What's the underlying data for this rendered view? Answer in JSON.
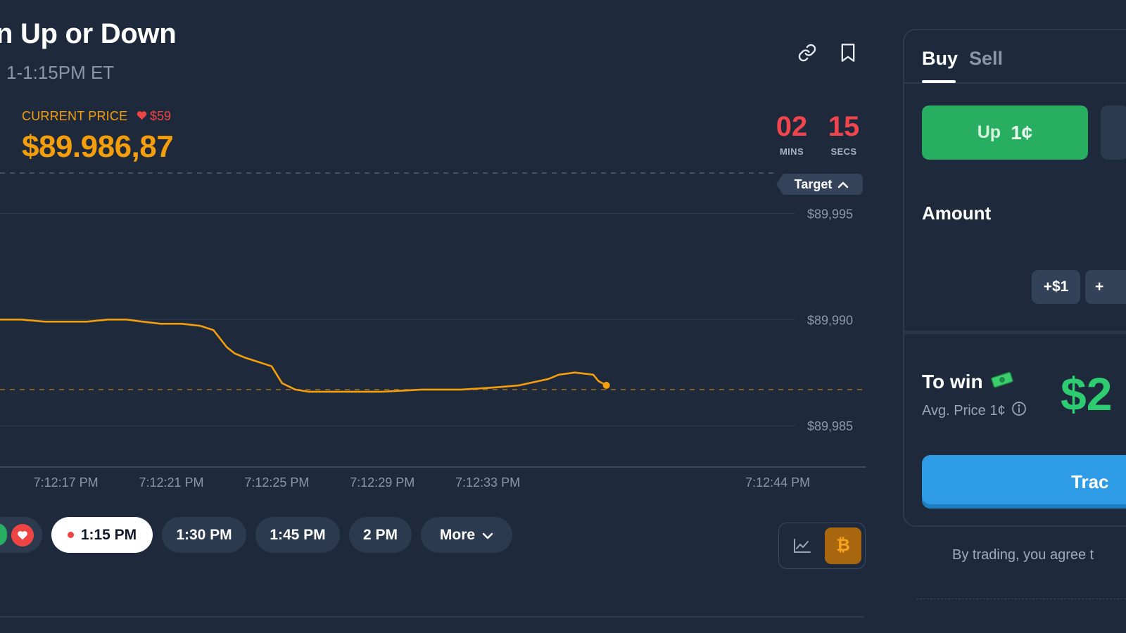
{
  "header": {
    "title": "n Up or Down",
    "subtitle": "1-1:15PM ET",
    "link_icon": "link-icon",
    "bookmark_icon": "bookmark-icon"
  },
  "price": {
    "label": "CURRENT PRICE",
    "change": "$59",
    "change_direction": "down",
    "value": "$89.986,87"
  },
  "countdown": {
    "mins": "02",
    "mins_label": "MINS",
    "secs": "15",
    "secs_label": "SECS"
  },
  "colors": {
    "background": "#1e2a3c",
    "accent_orange": "#f59e0b",
    "up_green": "#27ae60",
    "down_red": "#ef4444",
    "trade_blue": "#2e9be6"
  },
  "chart_data": {
    "type": "line",
    "target_label": "Target",
    "y_ticks": [
      "$89,995",
      "$89,990",
      "$89,985"
    ],
    "y_tick_values": [
      89995,
      89990,
      89985
    ],
    "ylim": [
      89983.05,
      89997.1
    ],
    "x_ticks": [
      "7:12:17 PM",
      "7:12:21 PM",
      "7:12:25 PM",
      "7:12:29 PM",
      "7:12:33 PM",
      "7:12:44 PM"
    ],
    "x_tick_values": [
      17,
      21,
      25,
      29,
      33,
      44
    ],
    "xlim": [
      14.5,
      47.6
    ],
    "target_value": 89996.9,
    "current_value": 89986.7,
    "series": [
      {
        "color": "#f59e0b",
        "x": [
          14.5,
          15.3,
          16.2,
          17.0,
          17.8,
          18.6,
          19.3,
          19.9,
          20.6,
          21.4,
          22.1,
          22.6,
          23.1,
          23.4,
          23.8,
          24.3,
          24.8,
          25.2,
          25.7,
          26.2,
          27.5,
          29.0,
          30.5,
          32.0,
          33.3,
          34.2,
          35.3,
          35.7,
          36.3,
          37.0,
          37.2,
          37.5
        ],
        "y": [
          89990.0,
          89990.0,
          89989.9,
          89989.9,
          89989.9,
          89990.0,
          89990.0,
          89989.9,
          89989.8,
          89989.8,
          89989.7,
          89989.5,
          89988.7,
          89988.4,
          89988.2,
          89988.0,
          89987.8,
          89987.0,
          89986.7,
          89986.6,
          89986.6,
          89986.6,
          89986.7,
          89986.7,
          89986.8,
          89986.9,
          89987.2,
          89987.4,
          89987.5,
          89987.4,
          89987.1,
          89986.9
        ]
      }
    ],
    "grid": true,
    "legend": "none"
  },
  "time_chips": {
    "active": "1:15 PM",
    "options": [
      "1:30 PM",
      "1:45 PM",
      "2 PM"
    ],
    "more": "More"
  },
  "view_toggle": {
    "chart_icon": "line-chart-icon",
    "coin_icon": "bitcoin-icon",
    "coin_symbol": "₿"
  },
  "order_panel": {
    "tab_buy": "Buy",
    "tab_sell": "Sell",
    "up_label": "Up",
    "up_price": "1¢",
    "amount_label": "Amount",
    "quick_add_1": "+$1",
    "quick_add_2": "+",
    "to_win_label": "To win",
    "avg_price": "Avg. Price 1¢",
    "payout": "$2",
    "trade_button": "Trac",
    "terms": "By trading, you agree t"
  }
}
